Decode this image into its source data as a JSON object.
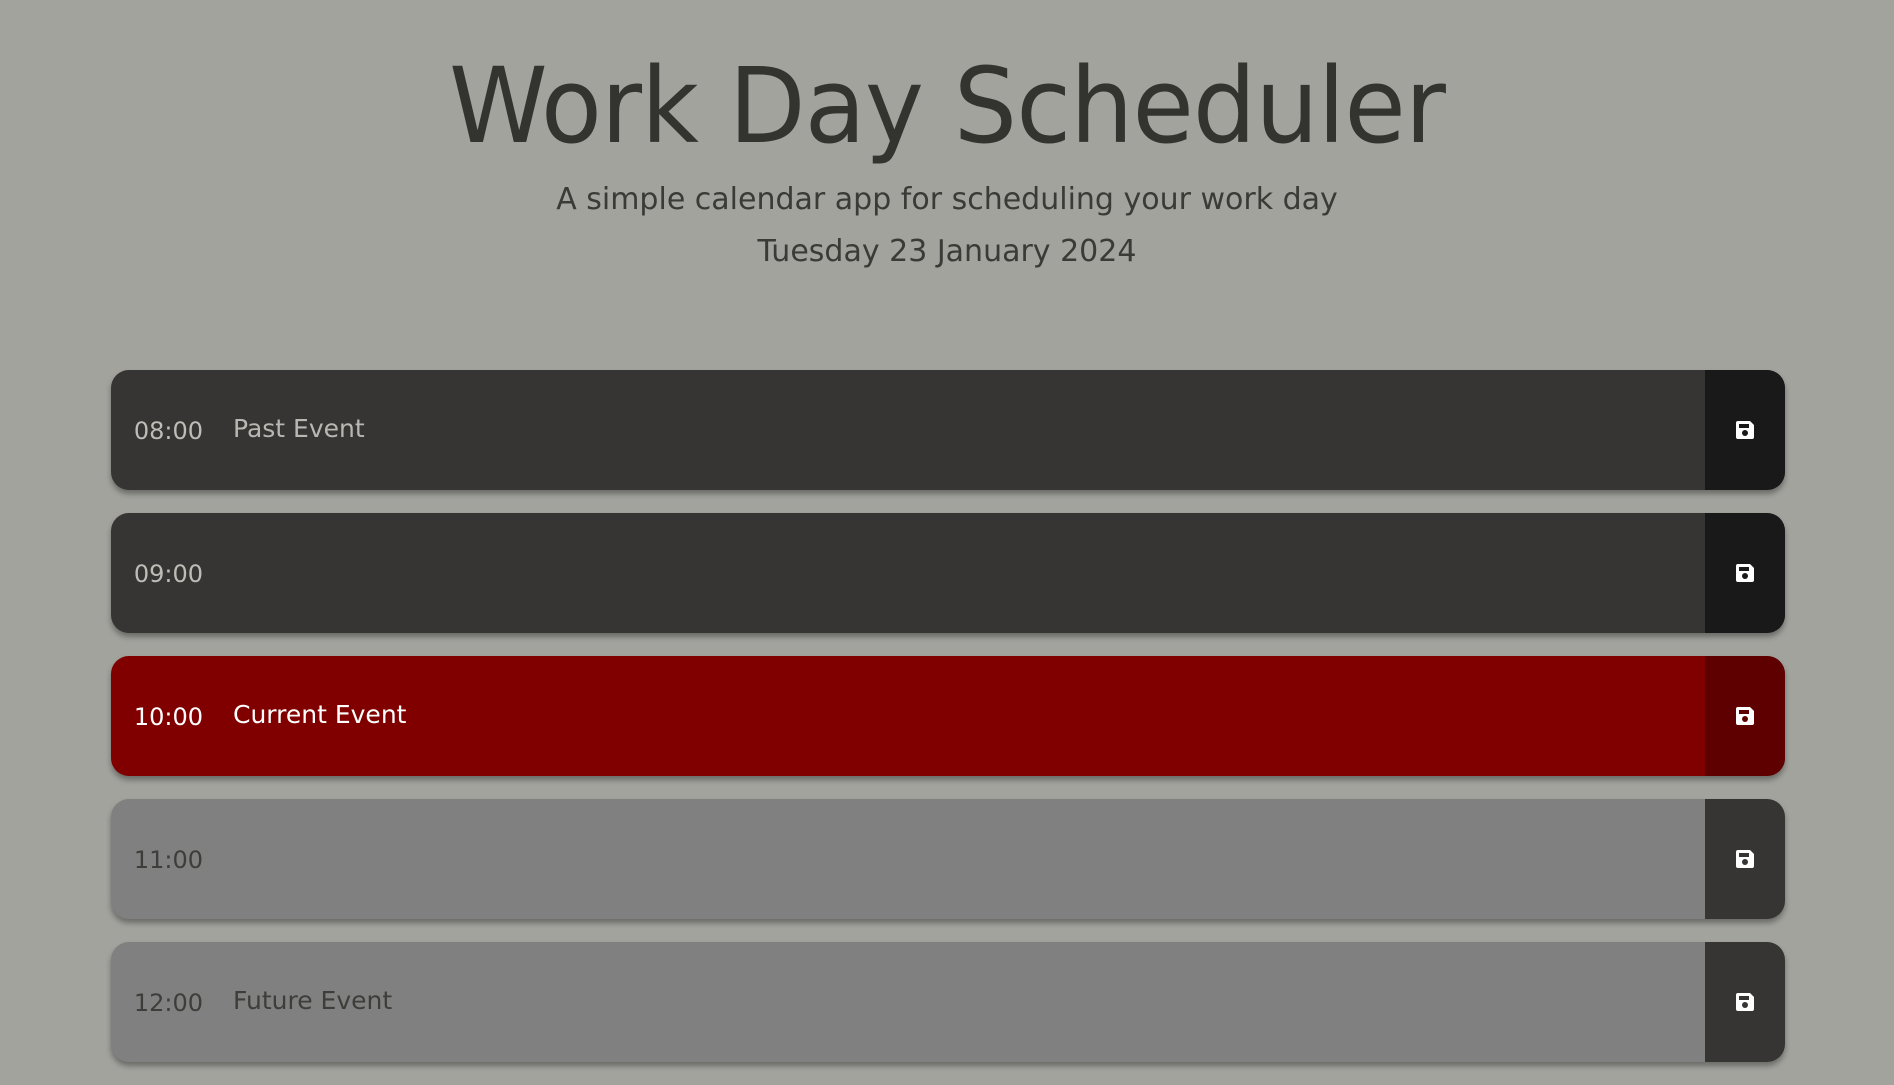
{
  "header": {
    "title": "Work Day Scheduler",
    "subtitle": "A simple calendar app for scheduling your work day",
    "date": "Tuesday 23 January 2024"
  },
  "colors": {
    "background": "#a3a39e",
    "past": "#363533",
    "present": "#800000",
    "future": "#808080"
  },
  "schedule": [
    {
      "hour": "08:00",
      "event": "Past Event",
      "state": "past",
      "save_icon": "save-icon"
    },
    {
      "hour": "09:00",
      "event": "",
      "state": "past",
      "save_icon": "save-icon"
    },
    {
      "hour": "10:00",
      "event": "Current Event",
      "state": "present",
      "save_icon": "save-icon"
    },
    {
      "hour": "11:00",
      "event": "",
      "state": "future",
      "save_icon": "save-icon"
    },
    {
      "hour": "12:00",
      "event": "Future Event",
      "state": "future",
      "save_icon": "save-icon"
    }
  ]
}
